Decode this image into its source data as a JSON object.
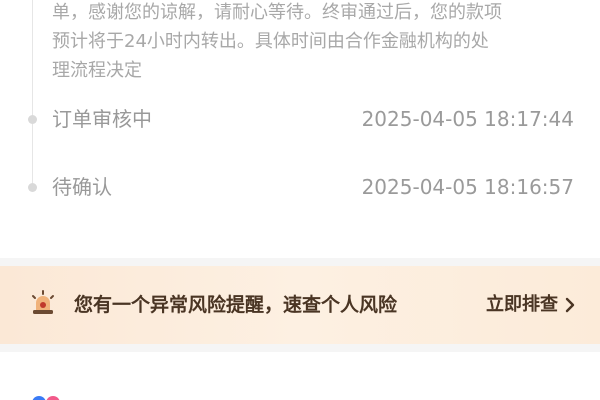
{
  "timeline": {
    "note_line1": "单，感谢您的谅解，请耐心等待。终审通过后，您的款项",
    "note_line2": "预计将于24小时内转出。具体时间由合作金融机构的处",
    "note_line3": "理流程决定",
    "events": [
      {
        "status": "订单审核中",
        "time": "2025-04-05 18:17:44"
      },
      {
        "status": "待确认",
        "time": "2025-04-05 18:16:57"
      }
    ]
  },
  "risk_banner": {
    "message": "您有一个异常风险提醒，速查个人风险",
    "action_label": "立即排查",
    "icon": "alarm-light-icon",
    "text_color": "#4a3524",
    "background": "#fcebd9"
  },
  "colors": {
    "muted_text": "#999999",
    "divider": "#f5f5f5"
  }
}
